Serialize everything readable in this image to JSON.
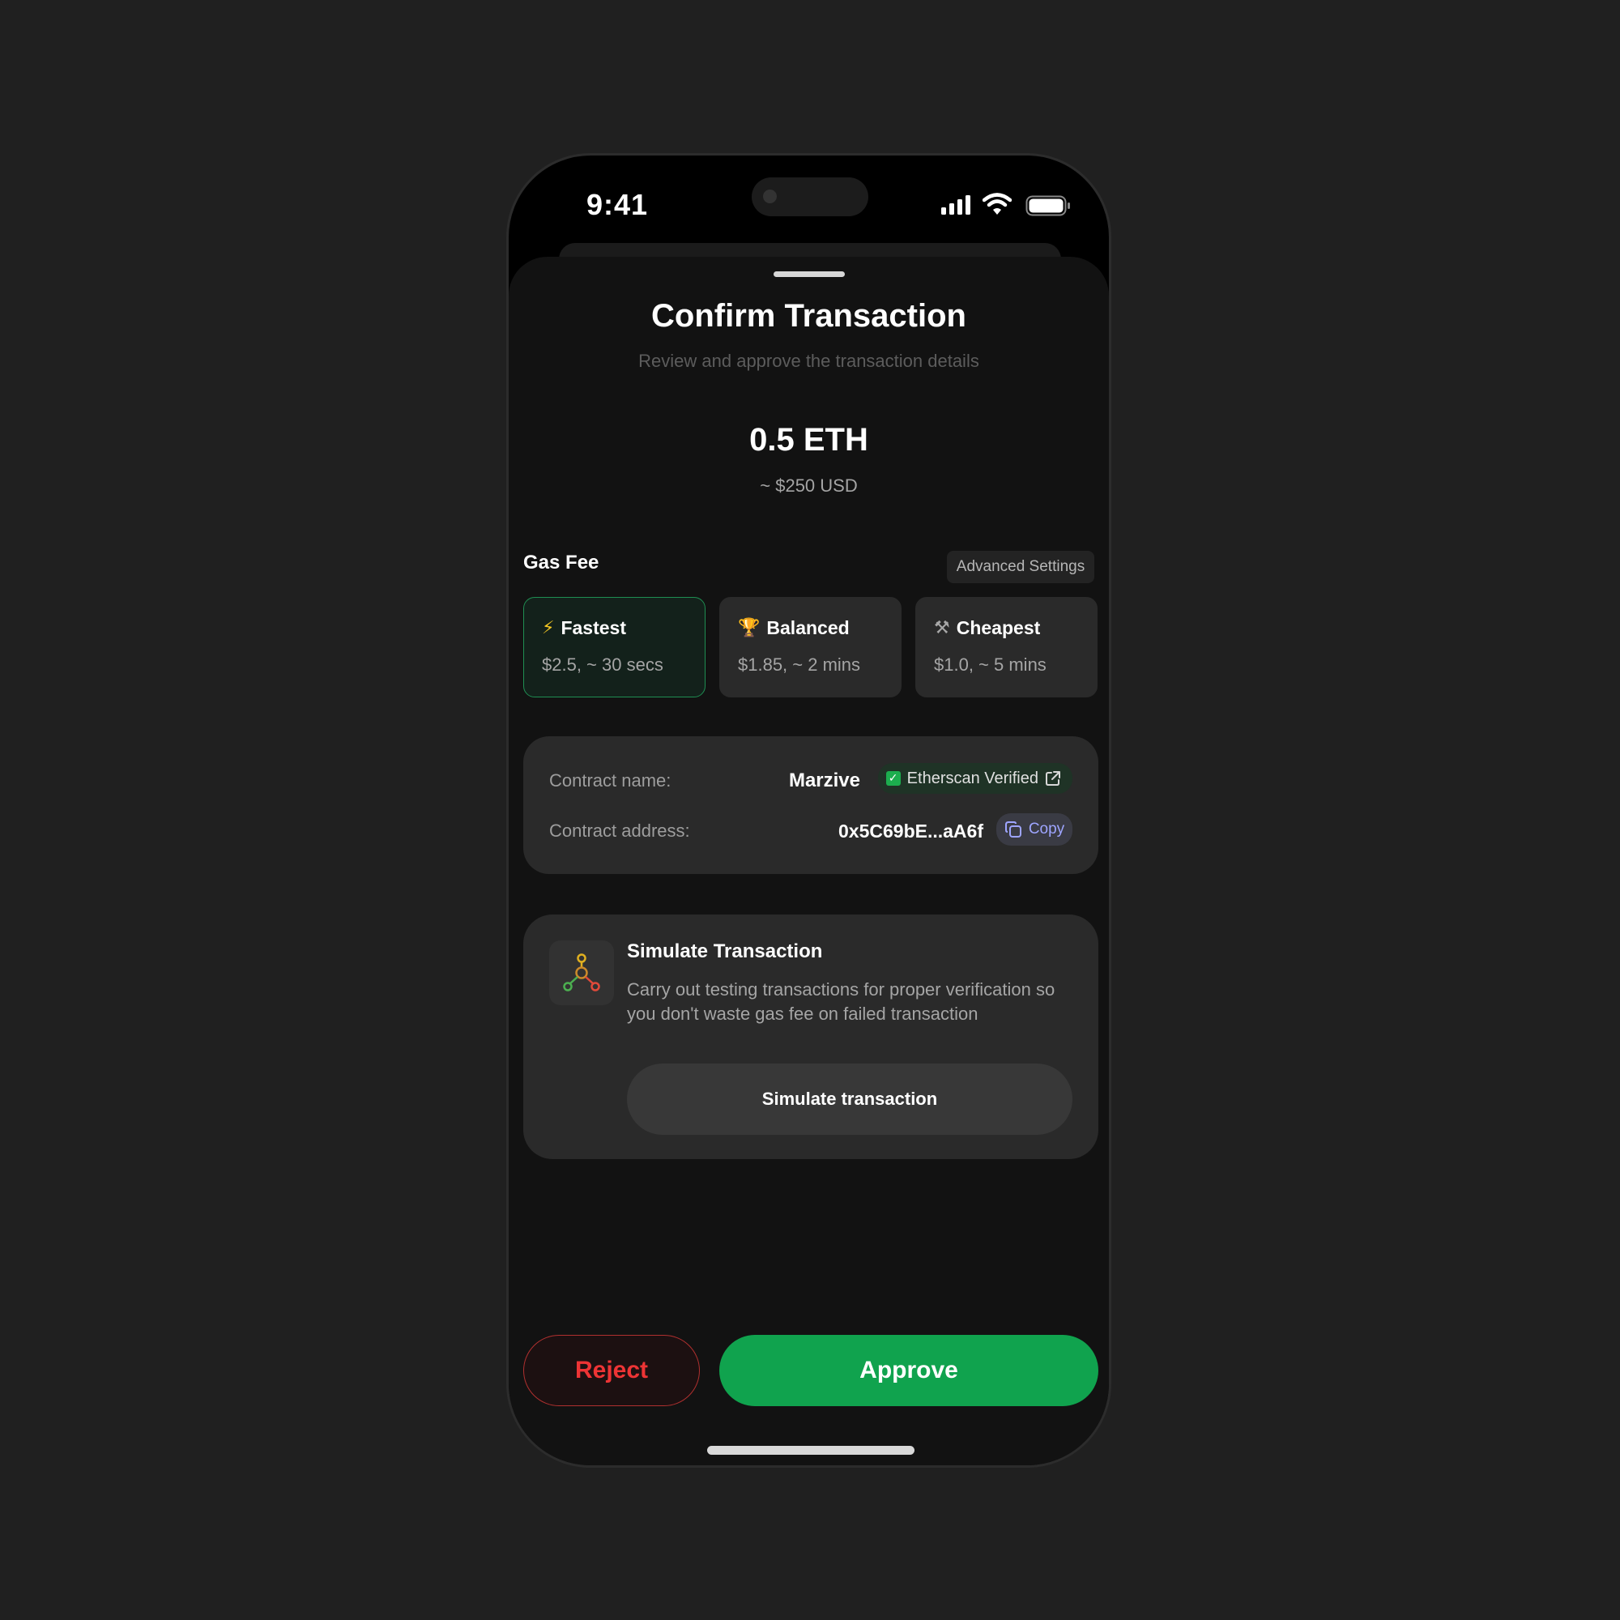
{
  "status_bar": {
    "time": "9:41"
  },
  "sheet": {
    "title": "Confirm Transaction",
    "subtitle": "Review and approve the transaction details"
  },
  "amount": {
    "value": "0.5 ETH",
    "fiat": "~ $250 USD"
  },
  "gas": {
    "label": "Gas Fee",
    "advanced_label": "Advanced Settings",
    "options": [
      {
        "name": "Fastest",
        "emoji": "⚡",
        "price": "$2.5, ~ 30 secs",
        "selected": true
      },
      {
        "name": "Balanced",
        "emoji": "🏆",
        "price": "$1.85, ~ 2 mins",
        "selected": false
      },
      {
        "name": "Cheapest",
        "emoji": "⚒",
        "price": "$1.0, ~ 5 mins",
        "selected": false
      }
    ]
  },
  "contract": {
    "name_label": "Contract name:",
    "name": "Marzive",
    "verified_label": "Etherscan Verified",
    "address_label": "Contract address:",
    "address": "0x5C69bE...aA6f",
    "copy_label": "Copy"
  },
  "simulate": {
    "title": "Simulate Transaction",
    "description": "Carry out testing transactions for proper verification so you don't waste gas fee on failed transaction",
    "button_label": "Simulate transaction"
  },
  "actions": {
    "reject_label": "Reject",
    "approve_label": "Approve"
  },
  "colors": {
    "accent_green": "#10a34e",
    "reject_red": "#ed3435",
    "copy_blue": "#9ea5ff",
    "background": "#202020"
  }
}
